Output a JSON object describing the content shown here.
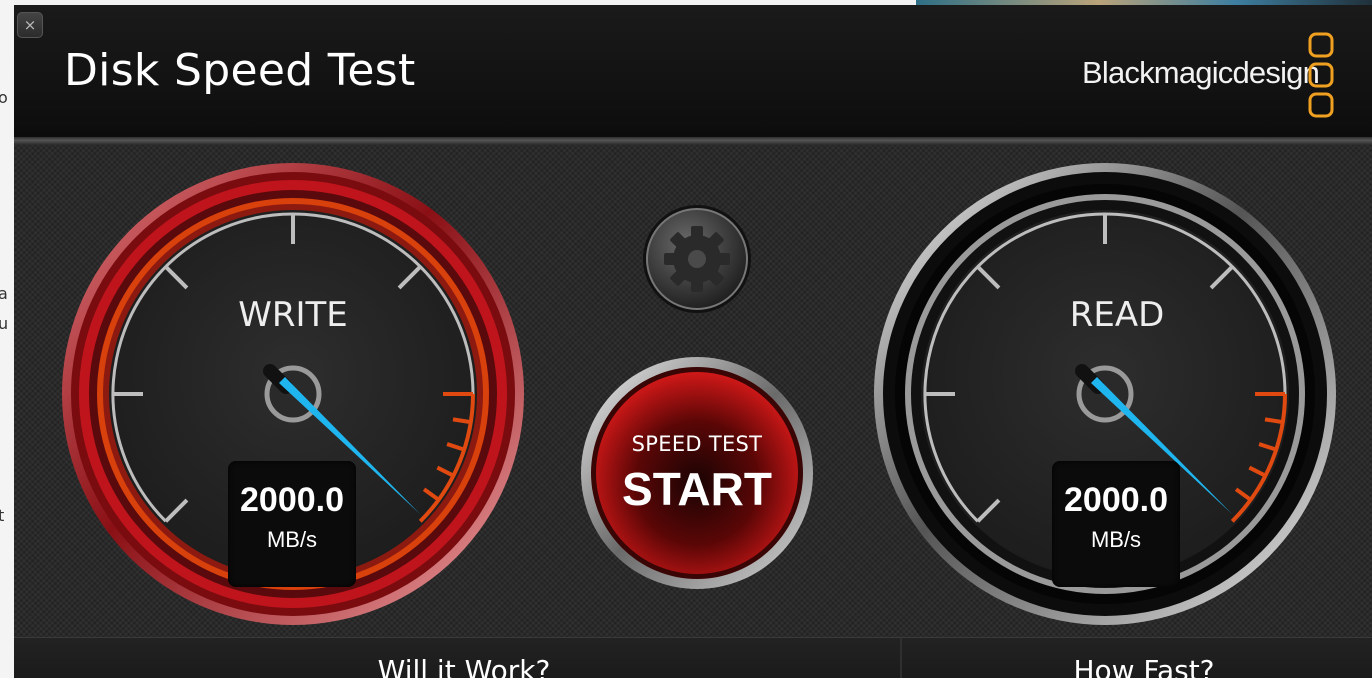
{
  "app": {
    "title": "Disk Speed Test",
    "brand": "Blackmagicdesign",
    "close_label": "×"
  },
  "background_fragments": [
    "o",
    "a",
    "u",
    "t"
  ],
  "gauges": {
    "write": {
      "label": "WRITE",
      "value": "2000.0",
      "unit": "MB/s",
      "ring_color": "#c0141c"
    },
    "read": {
      "label": "READ",
      "value": "2000.0",
      "unit": "MB/s",
      "ring_color": "#d8d8d8"
    }
  },
  "start_button": {
    "subtitle": "SPEED TEST",
    "label": "START"
  },
  "settings_button": {
    "icon": "gear-icon"
  },
  "bottom_tabs": {
    "will_it_work": "Will it Work?",
    "how_fast": "How Fast?"
  },
  "colors": {
    "needle": "#1fb6f0",
    "redline": "#e04a10",
    "brand_logo": "#f0a020"
  }
}
